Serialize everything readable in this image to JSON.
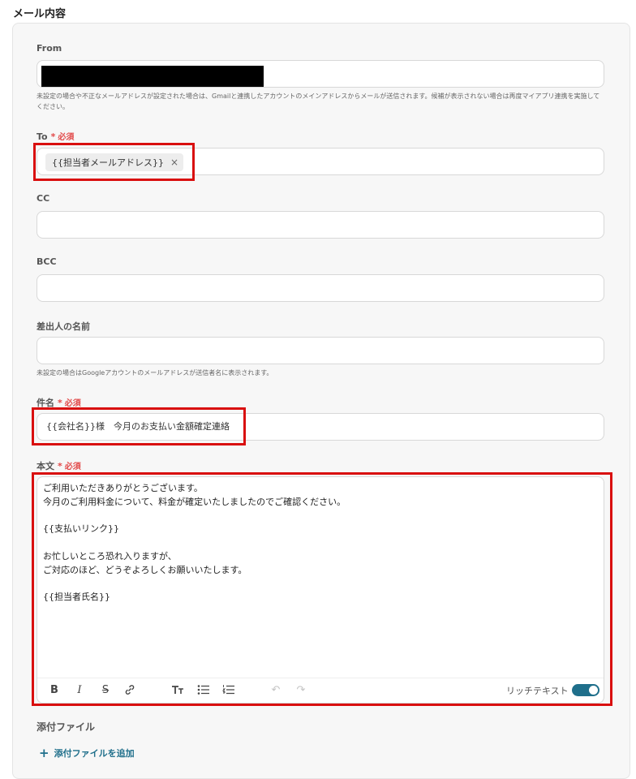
{
  "section_title": "メール内容",
  "fields": {
    "from": {
      "label": "From",
      "help": "未設定の場合や不正なメールアドレスが設定された場合は、Gmailと連携したアカウントのメインアドレスからメールが送信されます。候補が表示されない場合は再度マイアプリ連携を実施してください。"
    },
    "to": {
      "label": "To",
      "required_star": "*",
      "required": "必須",
      "chip": "{{担当者メールアドレス}}",
      "chip_remove": "×"
    },
    "cc": {
      "label": "CC"
    },
    "bcc": {
      "label": "BCC"
    },
    "sender_name": {
      "label": "差出人の名前",
      "help": "未設定の場合はGoogleアカウントのメールアドレスが送信者名に表示されます。"
    },
    "subject": {
      "label": "件名",
      "required_star": "*",
      "required": "必須",
      "value": "{{会社名}}様　今月のお支払い金額確定連絡"
    },
    "body": {
      "label": "本文",
      "required_star": "*",
      "required": "必須",
      "lines": [
        "ご利用いただきありがとうございます。",
        "今月のご利用料金について、料金が確定いたしましたのでご確認ください。",
        "{{支払いリンク}}",
        "お忙しいところ恐れ入りますが、",
        "ご対応のほど、どうぞよろしくお願いいたします。",
        "{{担当者氏名}}"
      ]
    }
  },
  "toolbar": {
    "bold": "B",
    "italic": "I",
    "strike": "S",
    "link": "🔗",
    "text_size": "ㅜT",
    "bullet_list": "☰",
    "numbered_list": "☰",
    "undo": "↶",
    "redo": "↷",
    "rich_text_label": "リッチテキスト",
    "rich_text_on": true
  },
  "attachments": {
    "label": "添付ファイル",
    "add_plus": "+",
    "add_label": "添付ファイルを追加"
  },
  "colors": {
    "accent": "#1f6f8b",
    "required": "#e24a4a",
    "highlight": "#d90f0f"
  }
}
